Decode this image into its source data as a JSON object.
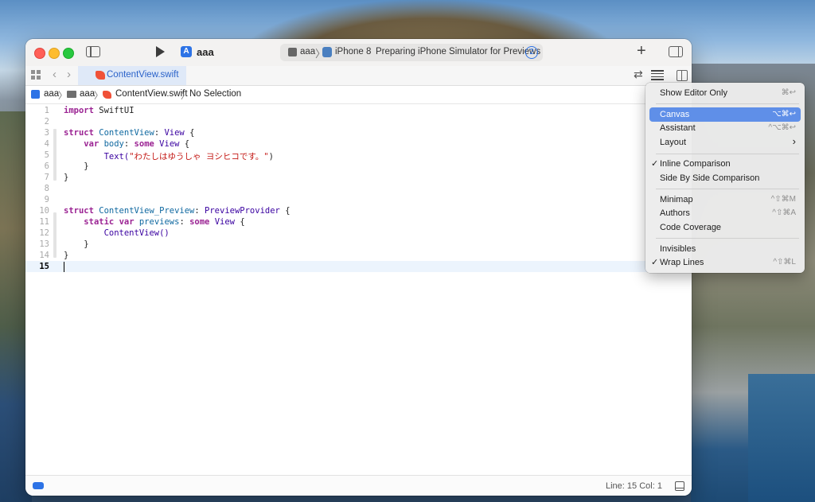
{
  "window": {
    "scheme_name": "aaa",
    "activity": {
      "target": "aaa",
      "separator": "〉",
      "device": "iPhone 8",
      "status": "Preparing iPhone Simulator for Previews",
      "badge": "2"
    },
    "add_button": "+"
  },
  "tabbar": {
    "back": "‹",
    "forward": "›",
    "active_tab": "ContentView.swift",
    "refresh_icon": "⇄"
  },
  "jumpbar": {
    "project": "aaa",
    "folder": "aaa",
    "file": "ContentView.swift",
    "selection": "No Selection",
    "sep": "〉"
  },
  "editor": {
    "lines": [
      {
        "n": "1"
      },
      {
        "n": "2"
      },
      {
        "n": "3"
      },
      {
        "n": "4"
      },
      {
        "n": "5"
      },
      {
        "n": "6"
      },
      {
        "n": "7"
      },
      {
        "n": "8"
      },
      {
        "n": "9"
      },
      {
        "n": "10"
      },
      {
        "n": "11"
      },
      {
        "n": "12"
      },
      {
        "n": "13"
      },
      {
        "n": "14"
      },
      {
        "n": "15"
      }
    ],
    "tokens": {
      "import": "import",
      "swiftui": "SwiftUI",
      "struct": "struct",
      "contentview_decl": "ContentView",
      "colon": ":",
      "view": "View",
      "brace_open": "{",
      "brace_close": "}",
      "var": "var",
      "body": "body",
      "some": "some",
      "text_call": "Text(",
      "text_string": "\"わたしはゆうしゃ ヨシヒコです。\"",
      "paren_close": ")",
      "preview_decl": "ContentView_Preview",
      "preview_provider": "PreviewProvider",
      "static": "static",
      "previews": "previews",
      "contentview_call": "ContentView()"
    },
    "current_line": "15"
  },
  "status": {
    "position": "Line: 15  Col: 1"
  },
  "menu": {
    "items": [
      {
        "label": "Show Editor Only",
        "shortcut": "⌘↩",
        "checked": ""
      },
      {
        "label": "Canvas",
        "shortcut": "⌥⌘↩",
        "checked": ""
      },
      {
        "label": "Assistant",
        "shortcut": "^⌥⌘↩",
        "checked": ""
      },
      {
        "label": "Layout",
        "shortcut": "›",
        "checked": ""
      },
      {
        "label": "Inline Comparison",
        "shortcut": "",
        "checked": "✓"
      },
      {
        "label": "Side By Side Comparison",
        "shortcut": "",
        "checked": ""
      },
      {
        "label": "Minimap",
        "shortcut": "^⇧⌘M",
        "checked": ""
      },
      {
        "label": "Authors",
        "shortcut": "^⇧⌘A",
        "checked": ""
      },
      {
        "label": "Code Coverage",
        "shortcut": "",
        "checked": ""
      },
      {
        "label": "Invisibles",
        "shortcut": "",
        "checked": ""
      },
      {
        "label": "Wrap Lines",
        "shortcut": "^⇧⌘L",
        "checked": "✓"
      }
    ],
    "highlighted": "Canvas"
  }
}
